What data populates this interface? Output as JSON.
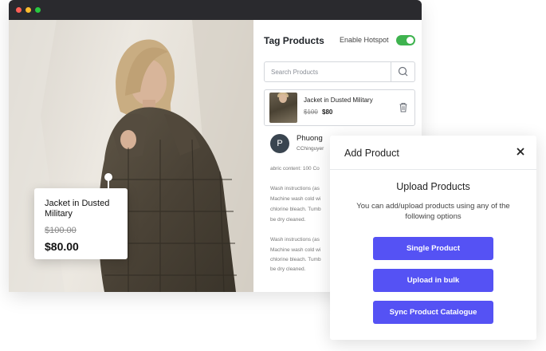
{
  "panel": {
    "title": "Tag Products",
    "enable_hotspot_label": "Enable Hotspot",
    "search_placeholder": "Search Products",
    "product": {
      "name": "Jacket in Dusted Military",
      "old_price": "$100",
      "new_price": "$80"
    },
    "review": {
      "avatar_initial": "P",
      "name": "Phuong",
      "handle": "CChinguyer",
      "lines": [
        "abric content: 100 Co",
        "Wash instructions (as",
        "Machine wash cold wi",
        "chlorine bleach.  Tumb",
        "be dry cleaned.",
        "Wash instructions (as",
        "Machine wash cold wi",
        "chlorine bleach.  Tumb",
        "be dry cleaned."
      ]
    }
  },
  "hotspot_card": {
    "name": "Jacket in Dusted Military",
    "old_price": "$100.00",
    "new_price": "$80.00"
  },
  "modal": {
    "title": "Add Product",
    "heading": "Upload Products",
    "description": "You can add/upload products using any of the following options",
    "buttons": [
      "Single Product",
      "Upload in bulk",
      "Sync Product Catalogue"
    ]
  },
  "colors": {
    "accent": "#5552f4",
    "toggle": "#3fb34f",
    "titlebar": "#2a2a2e"
  }
}
